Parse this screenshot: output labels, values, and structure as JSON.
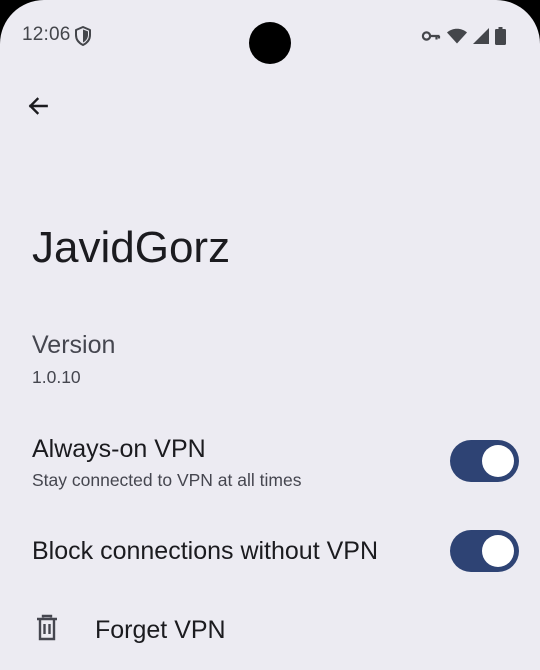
{
  "status_bar": {
    "time": "12:06",
    "icons": [
      "shield-icon",
      "vpn-key-icon",
      "wifi-icon",
      "cellular-signal-icon",
      "battery-icon"
    ]
  },
  "toolbar": {
    "back_icon": "arrow-back-icon"
  },
  "page": {
    "title": "JavidGorz"
  },
  "version": {
    "title": "Version",
    "value": "1.0.10"
  },
  "always_on": {
    "title": "Always-on VPN",
    "summary": "Stay connected to VPN at all times",
    "enabled": true
  },
  "block_connections": {
    "title": "Block connections without VPN",
    "enabled": true
  },
  "forget": {
    "title": "Forget VPN",
    "icon": "trash-icon"
  },
  "colors": {
    "background": "#ECEBF2",
    "toggle_on_track": "#2E4374",
    "toggle_thumb": "#FFFFFF",
    "text_primary": "#1B1B1F",
    "text_secondary": "#45464F"
  }
}
